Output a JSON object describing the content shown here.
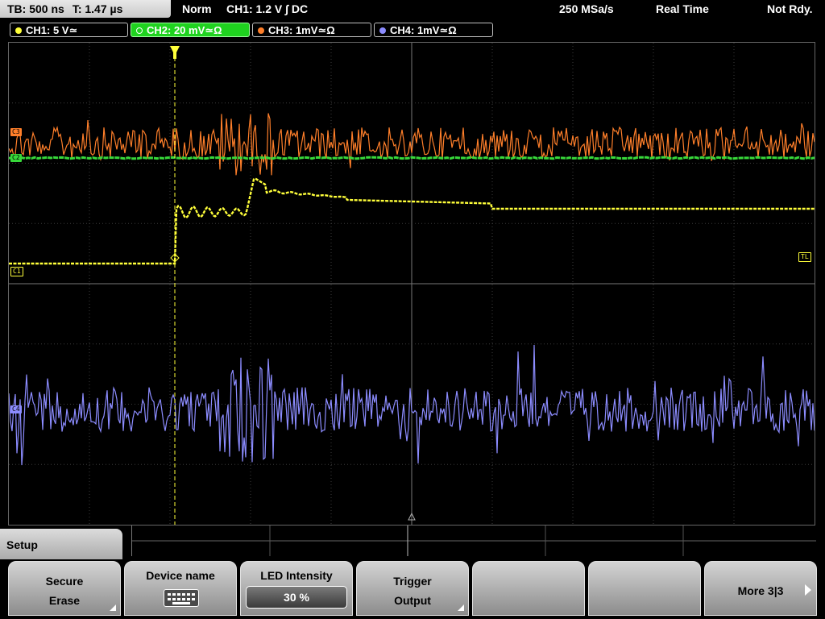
{
  "status": {
    "timebase": "TB: 500 ns",
    "trigger_time": "T: 1.47 µs",
    "mode": "Norm",
    "trigger_source": "CH1: 1.2 V ∫ DC",
    "sample_rate": "250 MSa/s",
    "acq_mode": "Real Time",
    "state": "Not Rdy."
  },
  "channels": [
    {
      "label": "CH1: 5 V≃",
      "color": "#ffff3a"
    },
    {
      "label": "CH2: 20 mV≃Ω",
      "color": "#37d83a",
      "active": true
    },
    {
      "label": "CH3: 1mV≃Ω",
      "color": "#ff7f2a"
    },
    {
      "label": "CH4: 1mV≃Ω",
      "color": "#8c8cff"
    }
  ],
  "markers": {
    "c3": "C3",
    "c2": "C2",
    "c1": "C1",
    "c4": "C4",
    "trigger_level": "TL"
  },
  "menu": {
    "tab": "Setup",
    "keys": [
      {
        "line1": "Secure",
        "line2": "Erase"
      },
      {
        "line1": "Device name"
      },
      {
        "line1": "LED Intensity",
        "value": "30 %"
      },
      {
        "line1": "Trigger",
        "line2": "Output"
      },
      {
        "line1": ""
      },
      {
        "line1": ""
      },
      {
        "line1": "More 3|3"
      }
    ]
  },
  "icons": {
    "keyboard": "keyboard-icon",
    "submenu": "submenu-corner-icon",
    "more": "chevron-right-icon",
    "trigger_pos": "trigger-position-icon"
  }
}
